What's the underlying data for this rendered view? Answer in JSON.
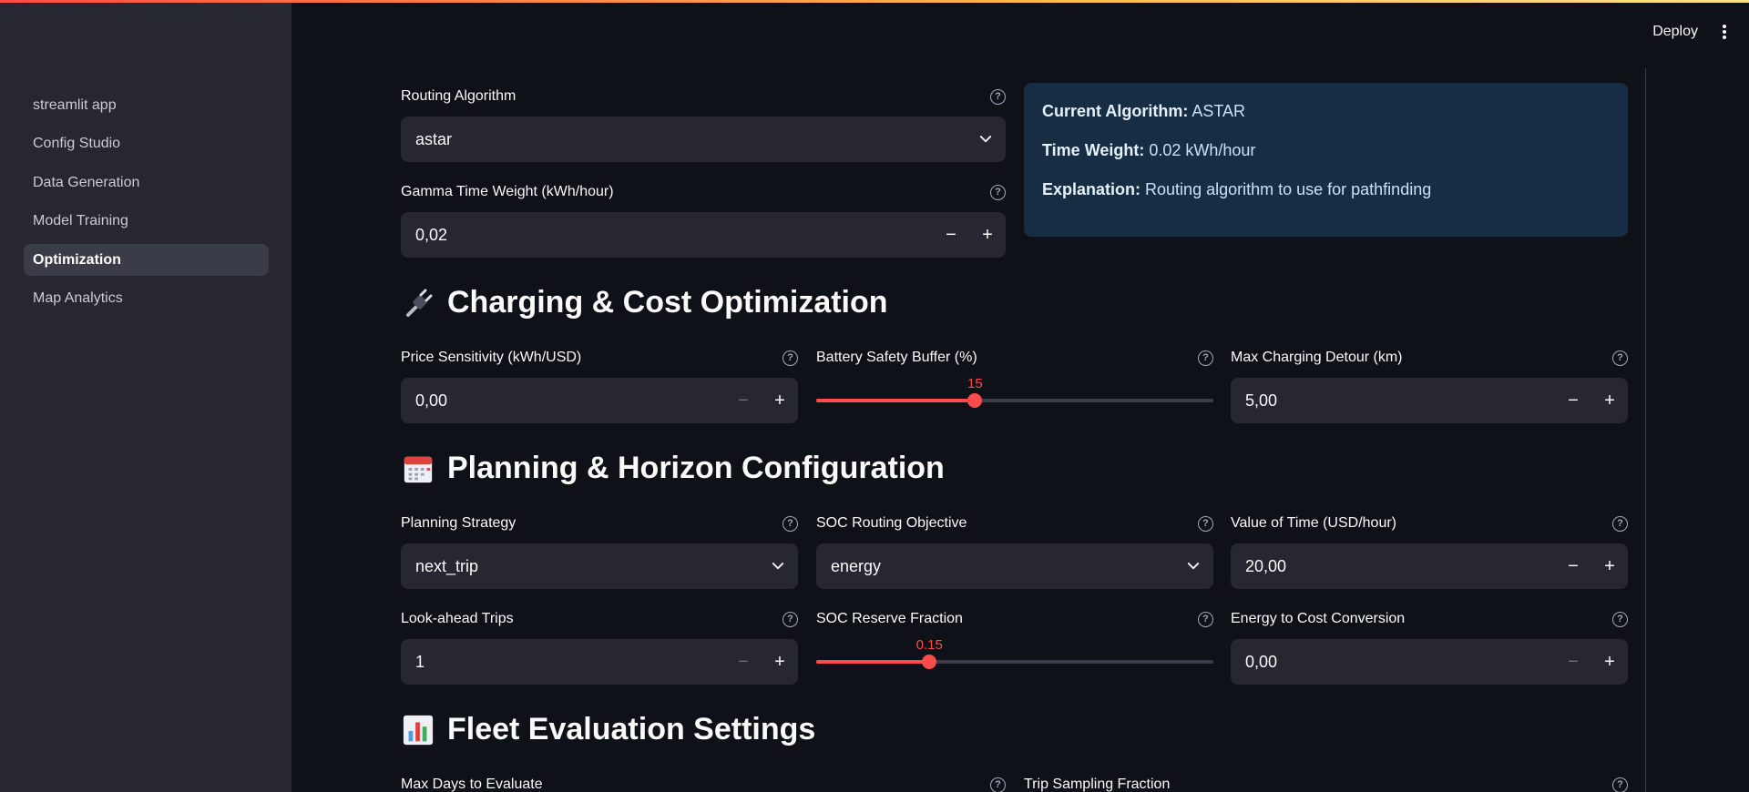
{
  "header": {
    "deploy_label": "Deploy"
  },
  "sidebar": {
    "items": [
      {
        "label": "streamlit app"
      },
      {
        "label": "Config Studio"
      },
      {
        "label": "Data Generation"
      },
      {
        "label": "Model Training"
      },
      {
        "label": "Optimization",
        "active": true
      },
      {
        "label": "Map Analytics"
      }
    ]
  },
  "routing": {
    "algorithm_label": "Routing Algorithm",
    "algorithm_value": "astar",
    "gamma_label": "Gamma Time Weight (kWh/hour)",
    "gamma_value": "0,02"
  },
  "info": {
    "algo_key": "Current Algorithm:",
    "algo_val": "ASTAR",
    "weight_key": "Time Weight:",
    "weight_val": "0.02 kWh/hour",
    "expl_key": "Explanation:",
    "expl_val": "Routing algorithm to use for pathfinding"
  },
  "charging": {
    "title": "Charging & Cost Optimization",
    "price_label": "Price Sensitivity (kWh/USD)",
    "price_value": "0,00",
    "buffer_label": "Battery Safety Buffer (%)",
    "buffer_value": "15",
    "buffer_fraction": 0.4,
    "detour_label": "Max Charging Detour (km)",
    "detour_value": "5,00"
  },
  "planning": {
    "title": "Planning & Horizon Configuration",
    "strategy_label": "Planning Strategy",
    "strategy_value": "next_trip",
    "objective_label": "SOC Routing Objective",
    "objective_value": "energy",
    "vot_label": "Value of Time (USD/hour)",
    "vot_value": "20,00",
    "lookahead_label": "Look-ahead Trips",
    "lookahead_value": "1",
    "reserve_label": "SOC Reserve Fraction",
    "reserve_value": "0.15",
    "reserve_fraction": 0.285,
    "e2c_label": "Energy to Cost Conversion",
    "e2c_value": "0,00"
  },
  "fleet": {
    "title": "Fleet Evaluation Settings",
    "maxdays_label": "Max Days to Evaluate",
    "sampling_label": "Trip Sampling Fraction"
  },
  "icons": {
    "help": "?",
    "minus": "−",
    "plus": "+",
    "plug": "plug-icon",
    "calendar": "calendar-icon",
    "chart": "bar-chart-icon"
  },
  "colors": {
    "accent": "#ff4b4b",
    "sidebar_bg": "#262730",
    "main_bg": "#0e1117",
    "info_bg": "#172d43"
  }
}
